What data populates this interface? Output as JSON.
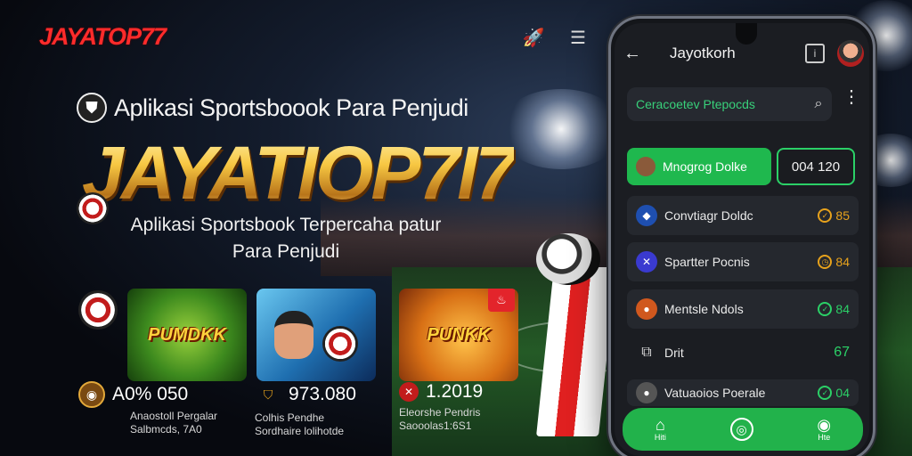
{
  "brand": {
    "logo": "JAYATOP77"
  },
  "header": {
    "rocket_icon": "rocket-icon",
    "menu_icon": "hamburger-icon"
  },
  "hero": {
    "subtitle": "Aplikasi Sportsboook Para Penjudi",
    "big_title": "JAYATIOP7I7",
    "tagline_line1": "Aplikasi Sportsbook Terpercaha patur",
    "tagline_line2": "Para Penjudi"
  },
  "games": [
    {
      "title": "PUMDKK"
    },
    {
      "title": ""
    },
    {
      "title": "PUNKK"
    }
  ],
  "stats": [
    {
      "value": "A0% 050",
      "line1": "Anaostoll Pergalar",
      "line2": "Salbmcds, 7A0"
    },
    {
      "value": "973.080",
      "line1": "Colhis Pendhe",
      "line2": "Sordhaire lolihotde"
    },
    {
      "value": "1.2019",
      "line1": "Eleorshe Pendris",
      "line2": "Saooolas1:6S1"
    }
  ],
  "phone": {
    "app_title": "Jayotkorh",
    "search_placeholder": "Ceracoetev Ptepocds",
    "selected": {
      "label": "Mnogrog Dolke",
      "odds": "004 120"
    },
    "items": [
      {
        "label": "Convtiagr Doldc",
        "odds": "85",
        "color": "#e7a21c"
      },
      {
        "label": "Spartter Pocnis",
        "odds": "84",
        "color": "#e7a21c"
      },
      {
        "label": "Mentsle Ndols",
        "odds": "84",
        "color": "#2bd067"
      },
      {
        "label": "Drit",
        "odds": "67",
        "color": "#2bd067"
      },
      {
        "label": "Vatuaoios Poerale",
        "odds": "04",
        "color": "#2bd067"
      }
    ],
    "nav": [
      "Hiti",
      "",
      "Hte"
    ]
  }
}
